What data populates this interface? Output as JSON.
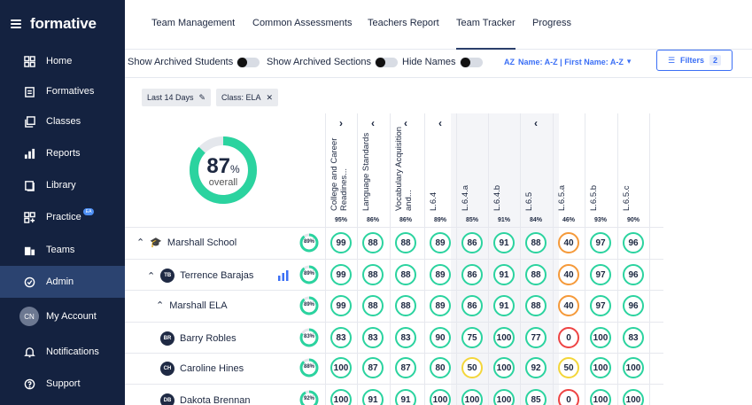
{
  "sidebar": {
    "logo": "formative",
    "items": [
      {
        "label": "Home",
        "icon": "grid-icon"
      },
      {
        "label": "Formatives",
        "icon": "clipboard-icon"
      },
      {
        "label": "Classes",
        "icon": "stack-icon"
      },
      {
        "label": "Reports",
        "icon": "bar-chart-icon"
      },
      {
        "label": "Library",
        "icon": "book-icon"
      },
      {
        "label": "Practice",
        "icon": "practice-icon",
        "badge": "EA"
      },
      {
        "label": "Teams",
        "icon": "building-icon"
      },
      {
        "label": "Admin",
        "icon": "check-circle-icon",
        "active": true
      },
      {
        "label": "My Account",
        "icon": "avatar",
        "initials": "CN"
      },
      {
        "label": "Notifications",
        "icon": "bell-icon"
      },
      {
        "label": "Support",
        "icon": "help-icon"
      }
    ]
  },
  "tabs": [
    "Team Management",
    "Common Assessments",
    "Teachers Report",
    "Team Tracker",
    "Progress"
  ],
  "active_tab": "Team Tracker",
  "toolbar": {
    "show_archived_students": "Show Archived Students",
    "show_archived_sections": "Show Archived Sections",
    "hide_names": "Hide Names",
    "sort_icon": "AZ",
    "sort": "Name: A-Z | First Name: A-Z",
    "filters": "Filters",
    "filters_count": "2"
  },
  "chips": {
    "date": "Last 14 Days",
    "class": "Class: ELA"
  },
  "overall": {
    "value": "87",
    "unit": "%",
    "label": "overall",
    "fraction": 0.87
  },
  "columns": [
    {
      "label": "College and Career Readines...",
      "chevron": "›",
      "avg": "95%"
    },
    {
      "label": "Language Standards",
      "chevron": "‹",
      "avg": "86%"
    },
    {
      "label": "Vocabulary Acquisition and...",
      "chevron": "‹",
      "avg": "86%"
    },
    {
      "label": "L.6.4",
      "chevron": "‹",
      "avg": "89%"
    },
    {
      "label": "L.6.4.a",
      "chevron": "",
      "avg": "85%"
    },
    {
      "label": "L.6.4.b",
      "chevron": "",
      "avg": "91%"
    },
    {
      "label": "L.6.5",
      "chevron": "‹",
      "avg": "84%"
    },
    {
      "label": "L.6.5.a",
      "chevron": "",
      "avg": "46%"
    },
    {
      "label": "L.6.5.b",
      "chevron": "",
      "avg": "93%"
    },
    {
      "label": "L.6.5.c",
      "chevron": "",
      "avg": "90%"
    }
  ],
  "rows": [
    {
      "label": "Marshall School",
      "kind": "school",
      "avg": "89%",
      "avg_frac": 0.89,
      "scores": [
        "99",
        "88",
        "88",
        "89",
        "86",
        "91",
        "88",
        "40",
        "97",
        "96"
      ]
    },
    {
      "label": "Terrence Barajas",
      "kind": "teacher",
      "initials": "TB",
      "avg": "89%",
      "avg_frac": 0.89,
      "scores": [
        "99",
        "88",
        "88",
        "89",
        "86",
        "91",
        "88",
        "40",
        "97",
        "96"
      ]
    },
    {
      "label": "Marshall ELA",
      "kind": "class",
      "avg": "89%",
      "avg_frac": 0.89,
      "scores": [
        "99",
        "88",
        "88",
        "89",
        "86",
        "91",
        "88",
        "40",
        "97",
        "96"
      ]
    },
    {
      "label": "Barry Robles",
      "kind": "student",
      "initials": "BR",
      "avg": "83%",
      "avg_frac": 0.83,
      "scores": [
        "83",
        "83",
        "83",
        "90",
        "75",
        "100",
        "77",
        "0",
        "100",
        "83"
      ]
    },
    {
      "label": "Caroline Hines",
      "kind": "student",
      "initials": "CH",
      "avg": "88%",
      "avg_frac": 0.88,
      "scores": [
        "100",
        "87",
        "87",
        "80",
        "50",
        "100",
        "92",
        "50",
        "100",
        "100"
      ]
    },
    {
      "label": "Dakota Brennan",
      "kind": "student",
      "initials": "DB",
      "avg": "92%",
      "avg_frac": 0.92,
      "scores": [
        "100",
        "91",
        "91",
        "100",
        "100",
        "100",
        "85",
        "0",
        "100",
        "100"
      ]
    }
  ],
  "colors": {
    "green": "#2bd39f",
    "orange": "#f59a3a",
    "yellow": "#f3d63a",
    "red": "#ee4444",
    "accent": "#3b6ff5",
    "sidebar": "#142240"
  }
}
